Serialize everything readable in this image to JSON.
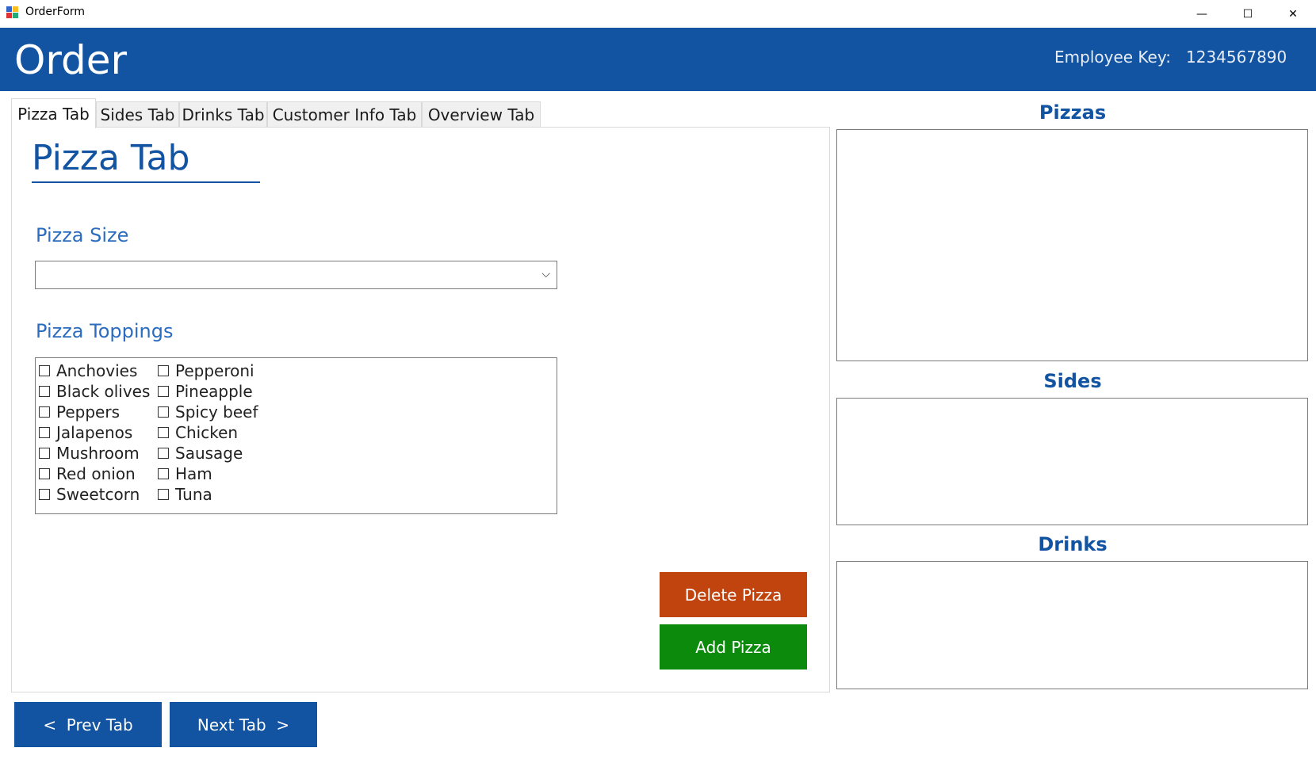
{
  "window": {
    "title": "OrderForm",
    "controls": {
      "minimize": "—",
      "maximize": "☐",
      "close": "✕"
    },
    "icon": "app-form-icon"
  },
  "header": {
    "title": "Order",
    "employee_key_label": "Employee Key:",
    "employee_key_value": "1234567890",
    "color": "#1253a2"
  },
  "tabs": [
    {
      "label": "Pizza Tab",
      "active": true
    },
    {
      "label": "Sides Tab",
      "active": false
    },
    {
      "label": "Drinks Tab",
      "active": false
    },
    {
      "label": "Customer Info Tab",
      "active": false
    },
    {
      "label": "Overview Tab",
      "active": false
    }
  ],
  "pizza_tab": {
    "heading": "Pizza Tab",
    "size_label": "Pizza Size",
    "size_value": "",
    "toppings_label": "Pizza Toppings",
    "toppings_col1": [
      "Anchovies",
      "Black olives",
      "Peppers",
      "Jalapenos",
      "Mushroom",
      "Red onion",
      "Sweetcorn"
    ],
    "toppings_col2": [
      "Pepperoni",
      "Pineapple",
      "Spicy beef",
      "Chicken",
      "Sausage",
      "Ham",
      "Tuna"
    ],
    "delete_label": "Delete Pizza",
    "add_label": "Add Pizza"
  },
  "navigation": {
    "prev_label": "<  Prev Tab",
    "next_label": "Next Tab  >"
  },
  "summary": {
    "pizzas_title": "Pizzas",
    "sides_title": "Sides",
    "drinks_title": "Drinks"
  },
  "colors": {
    "accent": "#1253a2",
    "delete": "#c1440e",
    "add": "#0b8a0b"
  }
}
